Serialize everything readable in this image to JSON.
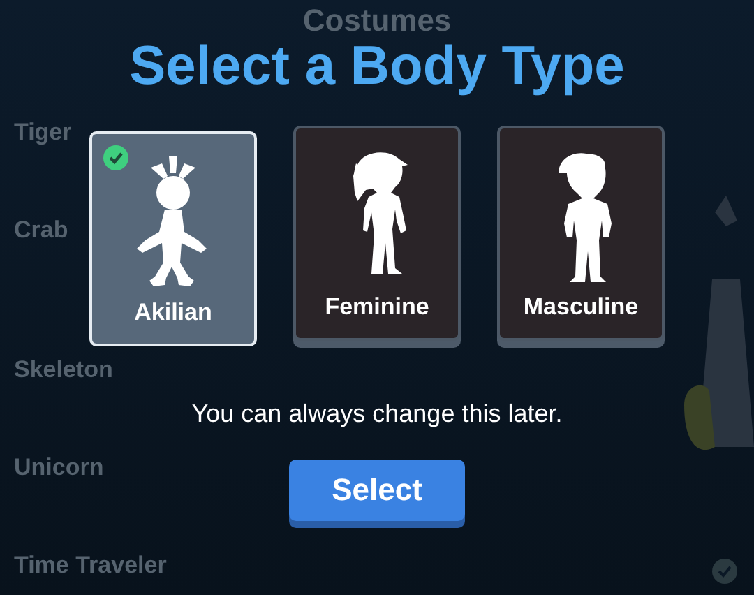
{
  "background": {
    "title": "Costumes",
    "costumes": [
      {
        "name": "Tiger"
      },
      {
        "name": "Crab"
      },
      {
        "name": "Skeleton"
      },
      {
        "name": "Unicorn"
      },
      {
        "name": "Time Traveler"
      }
    ]
  },
  "dialog": {
    "title": "Select a Body Type",
    "options": [
      {
        "label": "Akilian",
        "kind": "akilian",
        "selected": true
      },
      {
        "label": "Feminine",
        "kind": "feminine",
        "selected": false
      },
      {
        "label": "Masculine",
        "kind": "masculine",
        "selected": false
      }
    ],
    "note": "You can always change this later.",
    "button": "Select"
  }
}
